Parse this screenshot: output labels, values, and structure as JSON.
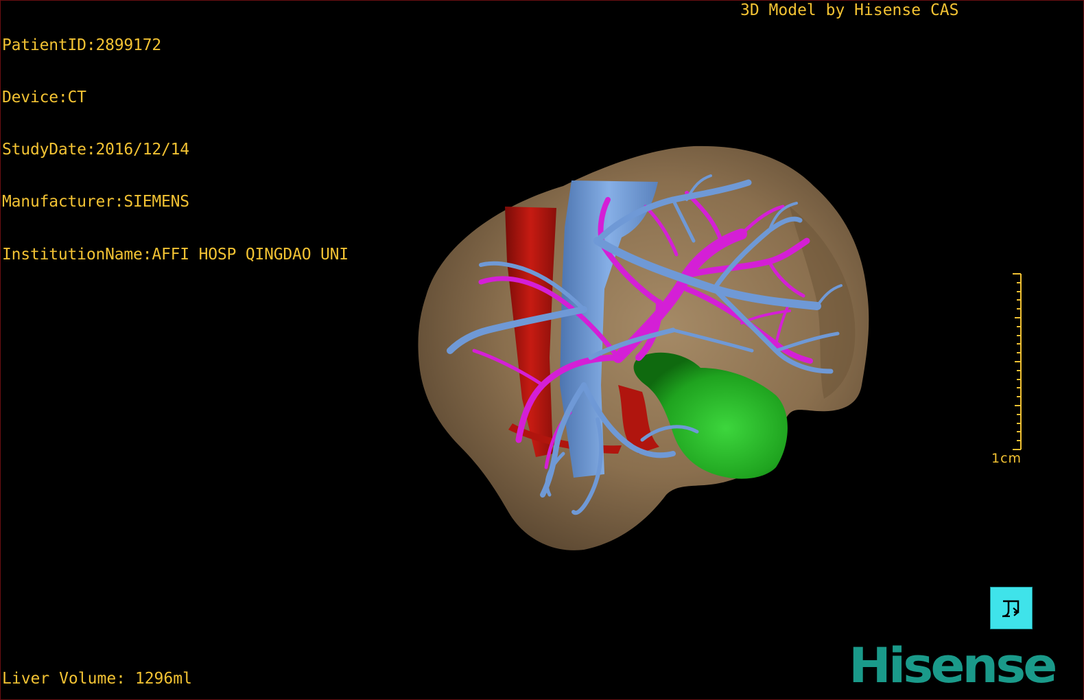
{
  "patient_info": {
    "patient_id": "PatientID:2899172",
    "device": "Device:CT",
    "study_date": "StudyDate:2016/12/14",
    "manufacturer": "Manufacturer:SIEMENS",
    "institution": "InstitutionName:AFFI HOSP QINGDAO UNI"
  },
  "credit": "3D Model by Hisense CAS",
  "liver_volume": "Liver Volume: 1296ml",
  "scale_bar": {
    "label": "1cm"
  },
  "brand": "Hisense",
  "colors": {
    "overlay_text": "#f2c233",
    "liver": "#8a6f4e",
    "hepatic_vein": "#6f99d6",
    "portal_vein": "#d41fd6",
    "artery": "#b0150e",
    "gallbladder": "#1fa31f",
    "tool_button": "#3fe3ea",
    "brand": "#1a9a8a"
  },
  "icons": {
    "tool_button": "rotate-3d-icon"
  }
}
